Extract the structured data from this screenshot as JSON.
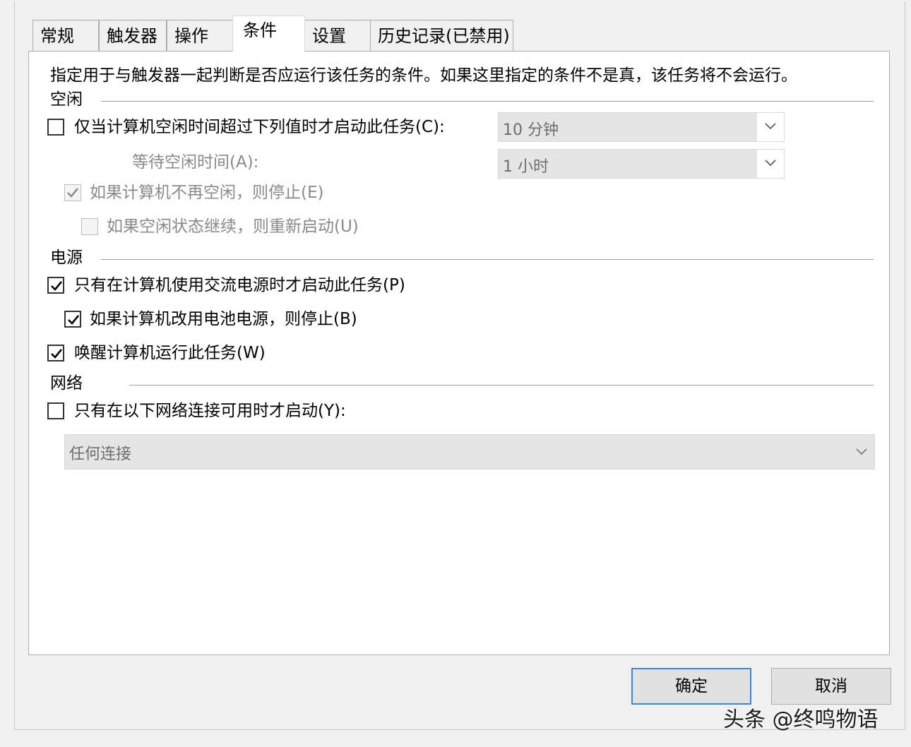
{
  "tabs": [
    {
      "label": "常规"
    },
    {
      "label": "触发器"
    },
    {
      "label": "操作"
    },
    {
      "label": "条件",
      "active": true
    },
    {
      "label": "设置"
    },
    {
      "label": "历史记录(已禁用)"
    }
  ],
  "description": "指定用于与触发器一起判断是否应运行该任务的条件。如果这里指定的条件不是真，该任务将不会运行。",
  "idle": {
    "section_label": "空闲",
    "start_if_idle": {
      "label": "仅当计算机空闲时间超过下列值时才启动此任务(C):",
      "checked": false
    },
    "idle_duration": {
      "value": "10 分钟"
    },
    "wait_label": "等待空闲时间(A):",
    "wait_duration": {
      "value": "1 小时"
    },
    "stop_if_not_idle": {
      "label": "如果计算机不再空闲，则停止(E)",
      "checked": true,
      "disabled": true
    },
    "restart_if_idle": {
      "label": "如果空闲状态继续，则重新启动(U)",
      "checked": false,
      "disabled": true
    }
  },
  "power": {
    "section_label": "电源",
    "ac_only": {
      "label": "只有在计算机使用交流电源时才启动此任务(P)",
      "checked": true
    },
    "stop_on_battery": {
      "label": "如果计算机改用电池电源，则停止(B)",
      "checked": true
    },
    "wake_to_run": {
      "label": "唤醒计算机运行此任务(W)",
      "checked": true
    }
  },
  "network": {
    "section_label": "网络",
    "start_if_network": {
      "label": "只有在以下网络连接可用时才启动(Y):",
      "checked": false
    },
    "connection": {
      "value": "任何连接"
    }
  },
  "buttons": {
    "ok": "确定",
    "cancel": "取消"
  },
  "watermark": "头条 @终鸣物语",
  "icons": {
    "check": "checkmark-icon",
    "dropdown": "chevron-down-icon"
  }
}
